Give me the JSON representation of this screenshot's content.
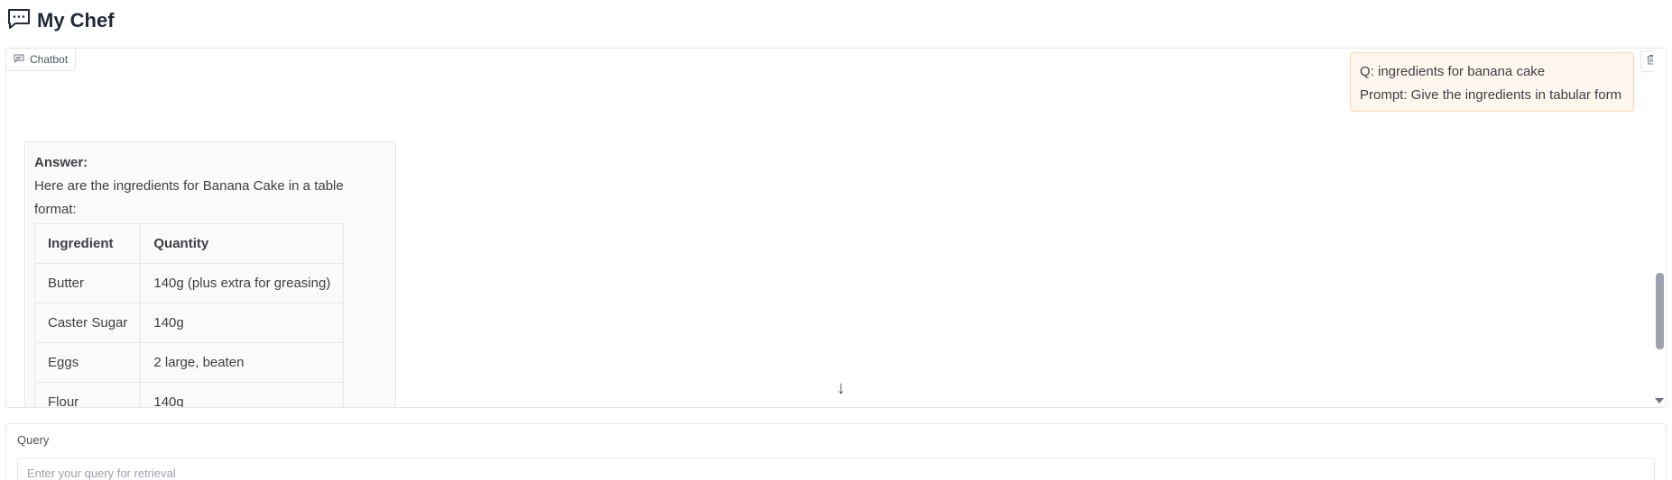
{
  "app": {
    "title": "My Chef",
    "icon": "chat-bubble-icon"
  },
  "chatbot": {
    "label": "Chatbot",
    "user_message": {
      "line1": "Q: ingredients for banana cake",
      "line2": "Prompt: Give the ingredients in tabular form"
    },
    "bot_message": {
      "answer_label": "Answer:",
      "intro": "Here are the ingredients for Banana Cake in a table format:",
      "table": {
        "headers": [
          "Ingredient",
          "Quantity"
        ],
        "rows": [
          [
            "Butter",
            "140g (plus extra for greasing)"
          ],
          [
            "Caster Sugar",
            "140g"
          ],
          [
            "Eggs",
            "2 large, beaten"
          ],
          [
            "Flour",
            "140g"
          ]
        ]
      }
    },
    "scroll_down_glyph": "↓"
  },
  "query": {
    "label": "Query",
    "placeholder": "Enter your query for retrieval",
    "value": ""
  },
  "colors": {
    "user_bubble_bg": "#fff7ed",
    "user_bubble_border": "#fed7aa",
    "bot_bubble_bg": "#fafafa"
  }
}
